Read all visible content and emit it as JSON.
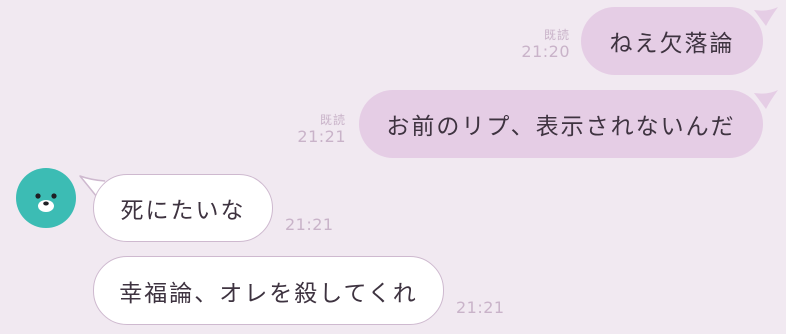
{
  "messages": [
    {
      "direction": "outgoing",
      "text": "ねえ欠落論",
      "read": "既読",
      "time": "21:20"
    },
    {
      "direction": "outgoing",
      "text": "お前のリプ、表示されないんだ",
      "read": "既読",
      "time": "21:21"
    },
    {
      "direction": "incoming",
      "text": "死にたいな",
      "time": "21:21",
      "avatar_icon": "bear-face-icon"
    },
    {
      "direction": "incoming",
      "text": "幸福論、オレを殺してくれ",
      "time": "21:21"
    }
  ],
  "colors": {
    "background": "#f1e9f1",
    "outgoing_bubble": "#e5cde5",
    "incoming_bubble": "#ffffff",
    "incoming_border": "#ceb9cf",
    "meta_text": "#c9b3c9",
    "message_text": "#3e3340",
    "avatar": "#3cbcb4"
  }
}
